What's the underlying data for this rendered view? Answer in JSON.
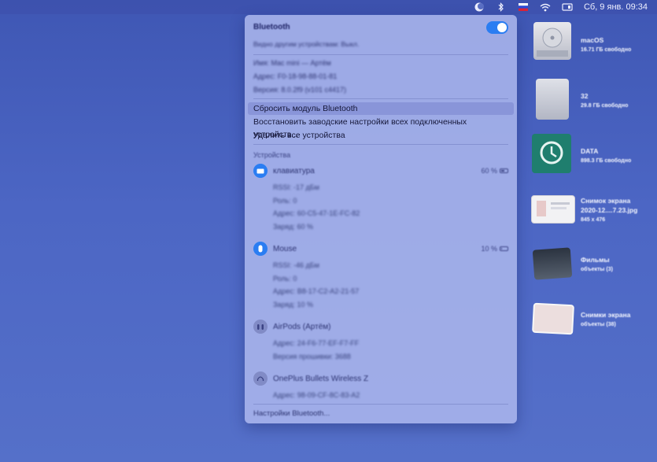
{
  "menubar": {
    "clock": "Сб, 9 янв.  09:34"
  },
  "bluetooth_panel": {
    "title": "Bluetooth",
    "subtitle": "Видно другим устройствам: Выкл.",
    "toggle_on": true,
    "info": {
      "name": "Имя: Mac mini — Артём",
      "address": "Адрес: F0-18-98-88-01-81",
      "version": "Версия: 8.0.2f9 (v101 c4417)"
    },
    "actions": {
      "reset": "Сбросить модуль Bluetooth",
      "restore": "Восстановить заводские настройки всех подключенных устройств...",
      "remove_all": "Удалить все устройства"
    },
    "devices_title": "Устройства",
    "devices": [
      {
        "name": "клавиатура",
        "battery": "60 %",
        "battery_level": 0.6,
        "rssi": "RSSI: -17 дБм",
        "role": "Роль: 0",
        "address": "Адрес: 60-C5-47-1E-FC-82",
        "charge": "Заряд: 60 %"
      },
      {
        "name": "Mouse",
        "battery": "10 %",
        "battery_level": 0.1,
        "rssi": "RSSI: -46 дБм",
        "role": "Роль: 0",
        "address": "Адрес: B8-17-C2-A2-21-57",
        "charge": "Заряд: 10 %"
      },
      {
        "name": "AirPods (Артём)",
        "address": "Адрес: 24-F6-77-EF-F7-FF",
        "firmware": "Версия прошивки: 3688"
      },
      {
        "name": "OnePlus Bullets Wireless Z",
        "address": "Адрес: 98-09-CF-8C-83-A2"
      }
    ],
    "settings_link": "Настройки Bluetooth..."
  },
  "desktop": {
    "items": [
      {
        "name": "macOS",
        "info": "16.71 ГБ свободно"
      },
      {
        "name": "32",
        "info": "29.8 ГБ свободно"
      },
      {
        "name": "DATA",
        "info": "898.3 ГБ свободно"
      },
      {
        "name": "Снимок экрана",
        "name2": "2020-12....7.23.jpg",
        "info": "845 x 476"
      },
      {
        "name": "Фильмы",
        "info": "объекты (3)"
      },
      {
        "name": "Снимки экрана",
        "info": "объекты (38)"
      }
    ]
  },
  "colors": {
    "accent": "#2a7df2",
    "desktop": "#4c66c4",
    "panel": "#aab5ec"
  }
}
